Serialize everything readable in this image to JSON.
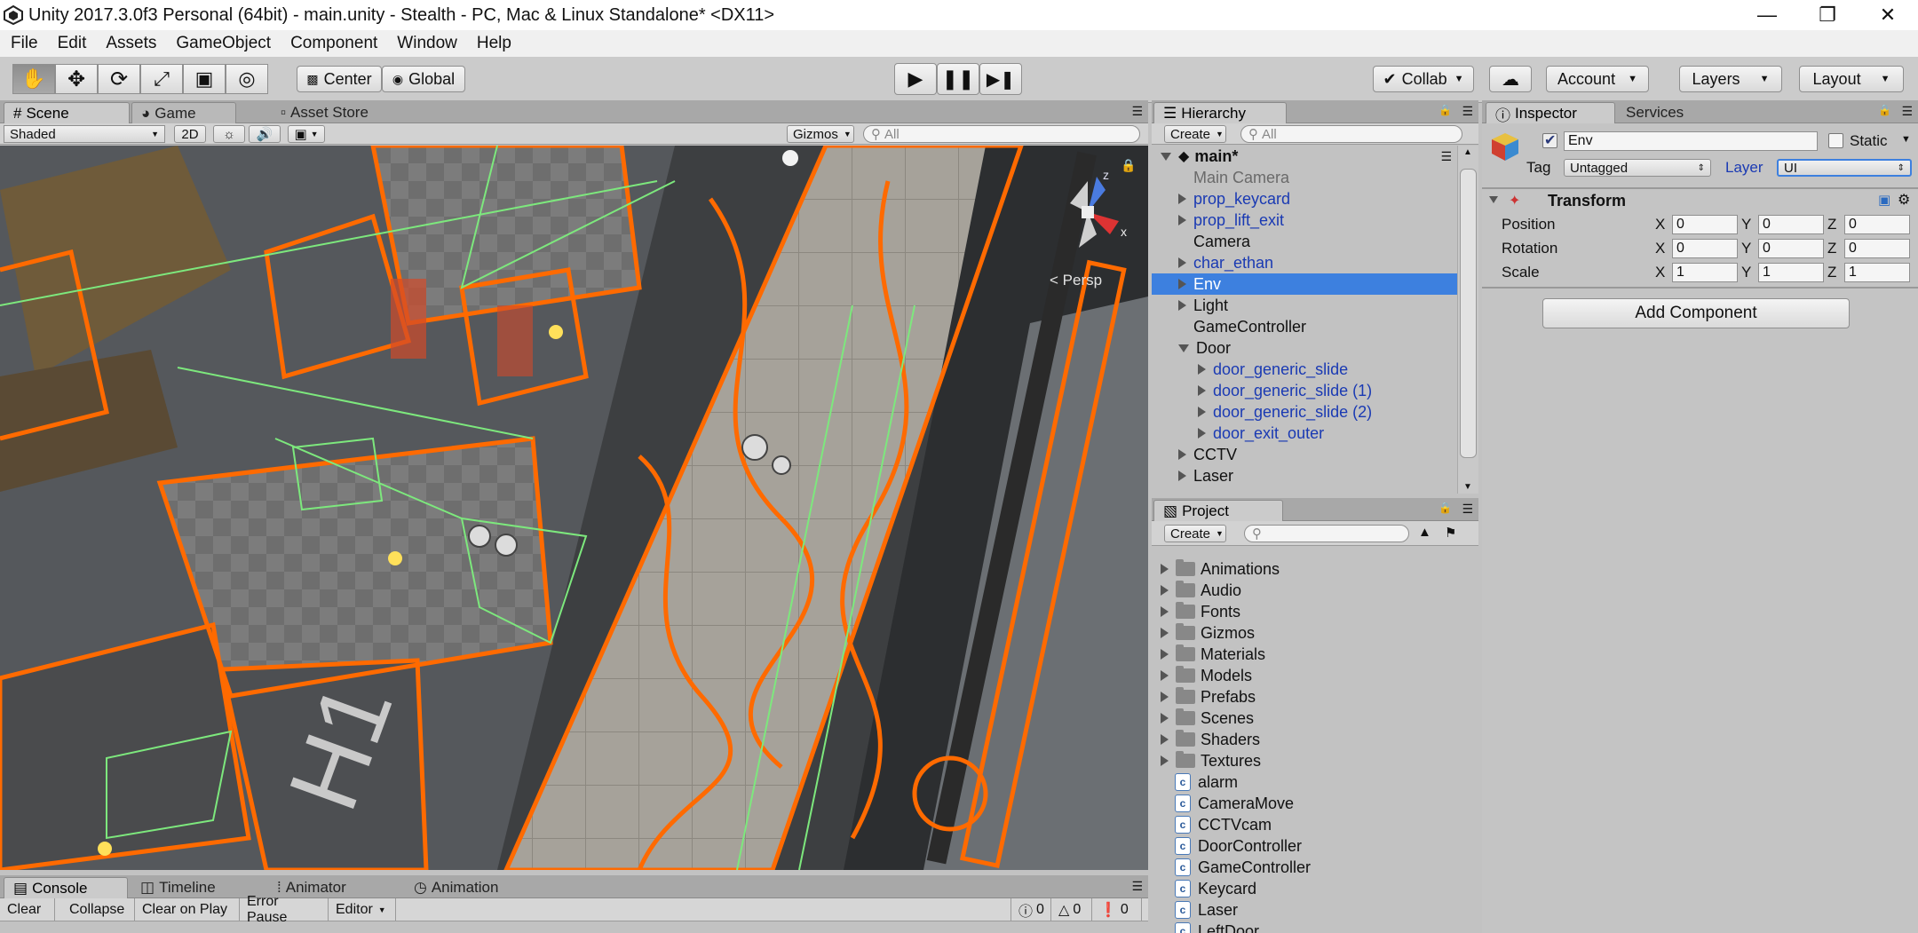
{
  "window": {
    "title": "Unity 2017.3.0f3 Personal (64bit) - main.unity - Stealth - PC, Mac & Linux Standalone* <DX11>"
  },
  "menu": [
    "File",
    "Edit",
    "Assets",
    "GameObject",
    "Component",
    "Window",
    "Help"
  ],
  "toolbar": {
    "pivot": "Center",
    "space": "Global",
    "collab": "Collab",
    "account": "Account",
    "layers": "Layers",
    "layout": "Layout"
  },
  "scene_panel": {
    "tabs": [
      "Scene",
      "Game",
      "Asset Store"
    ],
    "shading": "Shaded",
    "mode_2d": "2D",
    "gizmos": "Gizmos",
    "search_placeholder": "All",
    "persp_label": "< Persp",
    "gizmo_axes": {
      "y": "z",
      "x": "x"
    }
  },
  "hierarchy": {
    "tab": "Hierarchy",
    "create": "Create",
    "search_placeholder": "All",
    "scene": "main*",
    "items": [
      {
        "label": "Main Camera",
        "indent": 0,
        "arrow": "none",
        "style": "disabled"
      },
      {
        "label": "prop_keycard",
        "indent": 0,
        "arrow": "closed",
        "style": "prefab"
      },
      {
        "label": "prop_lift_exit",
        "indent": 0,
        "arrow": "closed",
        "style": "prefab"
      },
      {
        "label": "Camera",
        "indent": 0,
        "arrow": "none",
        "style": "normal"
      },
      {
        "label": "char_ethan",
        "indent": 0,
        "arrow": "closed",
        "style": "prefab"
      },
      {
        "label": "Env",
        "indent": 0,
        "arrow": "closed",
        "style": "selected"
      },
      {
        "label": "Light",
        "indent": 0,
        "arrow": "closed",
        "style": "normal"
      },
      {
        "label": "GameController",
        "indent": 0,
        "arrow": "none",
        "style": "normal"
      },
      {
        "label": "Door",
        "indent": 0,
        "arrow": "open",
        "style": "normal"
      },
      {
        "label": "door_generic_slide",
        "indent": 1,
        "arrow": "closed",
        "style": "prefab"
      },
      {
        "label": "door_generic_slide (1)",
        "indent": 1,
        "arrow": "closed",
        "style": "prefab"
      },
      {
        "label": "door_generic_slide (2)",
        "indent": 1,
        "arrow": "closed",
        "style": "prefab"
      },
      {
        "label": "door_exit_outer",
        "indent": 1,
        "arrow": "closed",
        "style": "prefab"
      },
      {
        "label": "CCTV",
        "indent": 0,
        "arrow": "closed",
        "style": "normal"
      },
      {
        "label": "Laser",
        "indent": 0,
        "arrow": "closed",
        "style": "normal"
      }
    ]
  },
  "project": {
    "tab": "Project",
    "create": "Create",
    "folders": [
      "Animations",
      "Audio",
      "Fonts",
      "Gizmos",
      "Materials",
      "Models",
      "Prefabs",
      "Scenes",
      "Shaders",
      "Textures"
    ],
    "scripts": [
      "alarm",
      "CameraMove",
      "CCTVcam",
      "DoorController",
      "GameController",
      "Keycard",
      "Laser",
      "LeftDoor"
    ]
  },
  "inspector": {
    "tabs": [
      "Inspector",
      "Services"
    ],
    "name": "Env",
    "static_label": "Static",
    "tag_label": "Tag",
    "tag_value": "Untagged",
    "layer_label": "Layer",
    "layer_value": "UI",
    "transform": {
      "title": "Transform",
      "rows": [
        {
          "label": "Position",
          "x": "0",
          "y": "0",
          "z": "0"
        },
        {
          "label": "Rotation",
          "x": "0",
          "y": "0",
          "z": "0"
        },
        {
          "label": "Scale",
          "x": "1",
          "y": "1",
          "z": "1"
        }
      ],
      "axis": [
        "X",
        "Y",
        "Z"
      ]
    },
    "add_component": "Add Component"
  },
  "bottom": {
    "tabs": [
      "Console",
      "Timeline",
      "Animator",
      "Animation"
    ],
    "buttons": [
      "Clear",
      "Collapse",
      "Clear on Play",
      "Error Pause",
      "Editor"
    ],
    "counts": {
      "info": "0",
      "warn": "0",
      "error": "0"
    }
  },
  "colors": {
    "selection": "#3d80df",
    "prefab": "#1a3ab3",
    "outline": "#ff6a00",
    "collider": "#7de87d"
  }
}
